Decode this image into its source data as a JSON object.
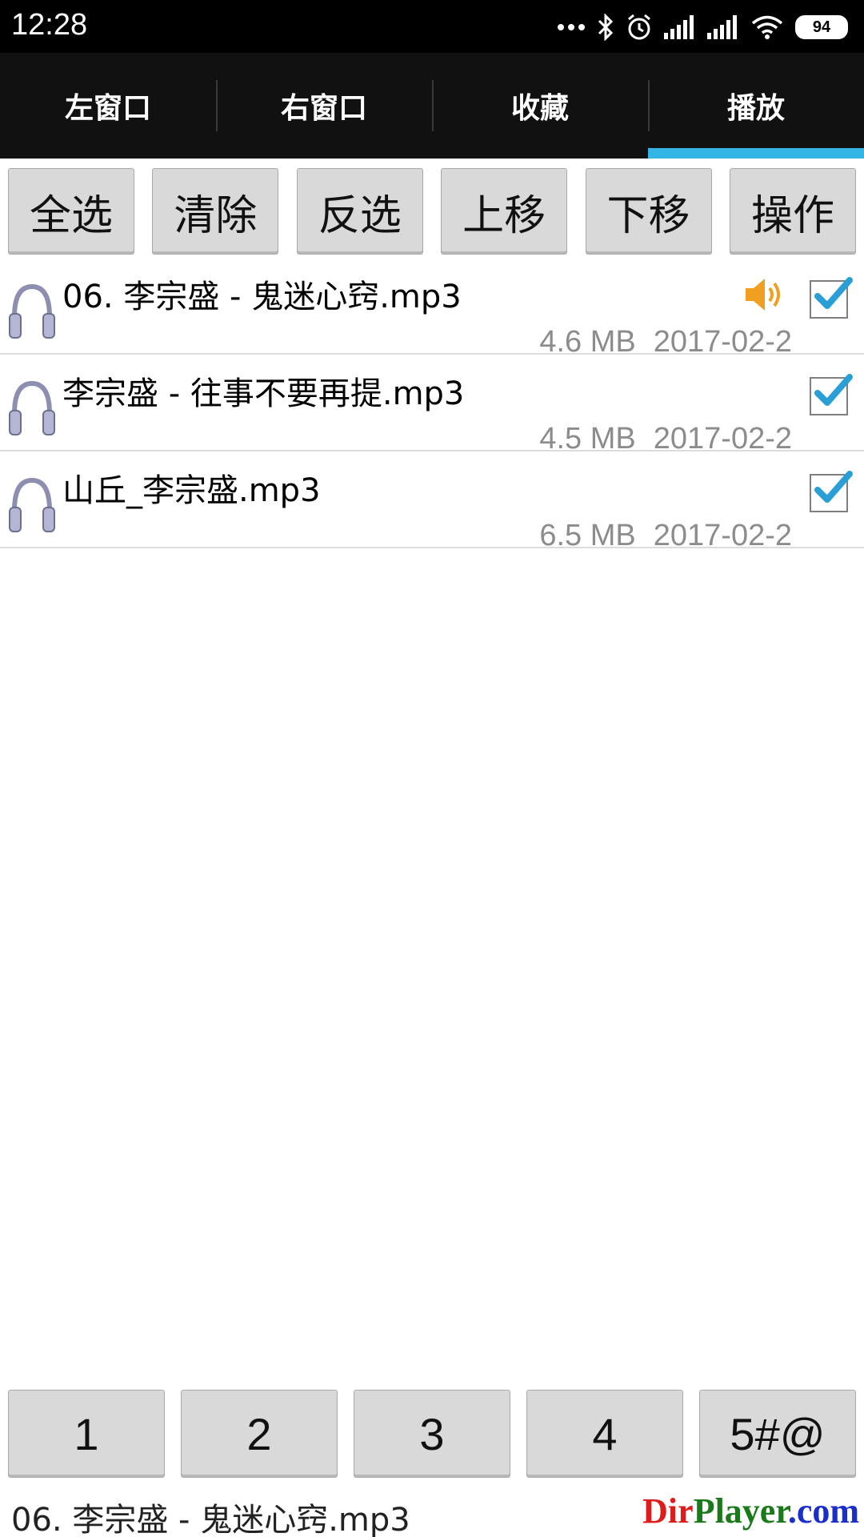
{
  "status": {
    "time": "12:28",
    "battery": "94"
  },
  "tabs": [
    {
      "label": "左窗口"
    },
    {
      "label": "右窗口"
    },
    {
      "label": "收藏"
    },
    {
      "label": "播放",
      "active": true
    }
  ],
  "toolbar": {
    "select_all": "全选",
    "clear": "清除",
    "invert": "反选",
    "move_up": "上移",
    "move_down": "下移",
    "actions": "操作"
  },
  "files": [
    {
      "name": "06. 李宗盛 - 鬼迷心窍.mp3",
      "size": "4.6 MB",
      "date": "2017-02-2",
      "playing": true,
      "checked": true
    },
    {
      "name": "李宗盛 - 往事不要再提.mp3",
      "size": "4.5 MB",
      "date": "2017-02-2",
      "playing": false,
      "checked": true
    },
    {
      "name": "山丘_李宗盛.mp3",
      "size": "6.5 MB",
      "date": "2017-02-2",
      "playing": false,
      "checked": true
    }
  ],
  "numbar": [
    "1",
    "2",
    "3",
    "4",
    "5#@"
  ],
  "now_playing": "06. 李宗盛 - 鬼迷心窍.mp3",
  "brand": {
    "part1": "Dir",
    "part2": "Player",
    "part3": ".com"
  },
  "colors": {
    "accent": "#33b5e5",
    "speaker": "#f0a020",
    "check": "#2a9fd6"
  }
}
